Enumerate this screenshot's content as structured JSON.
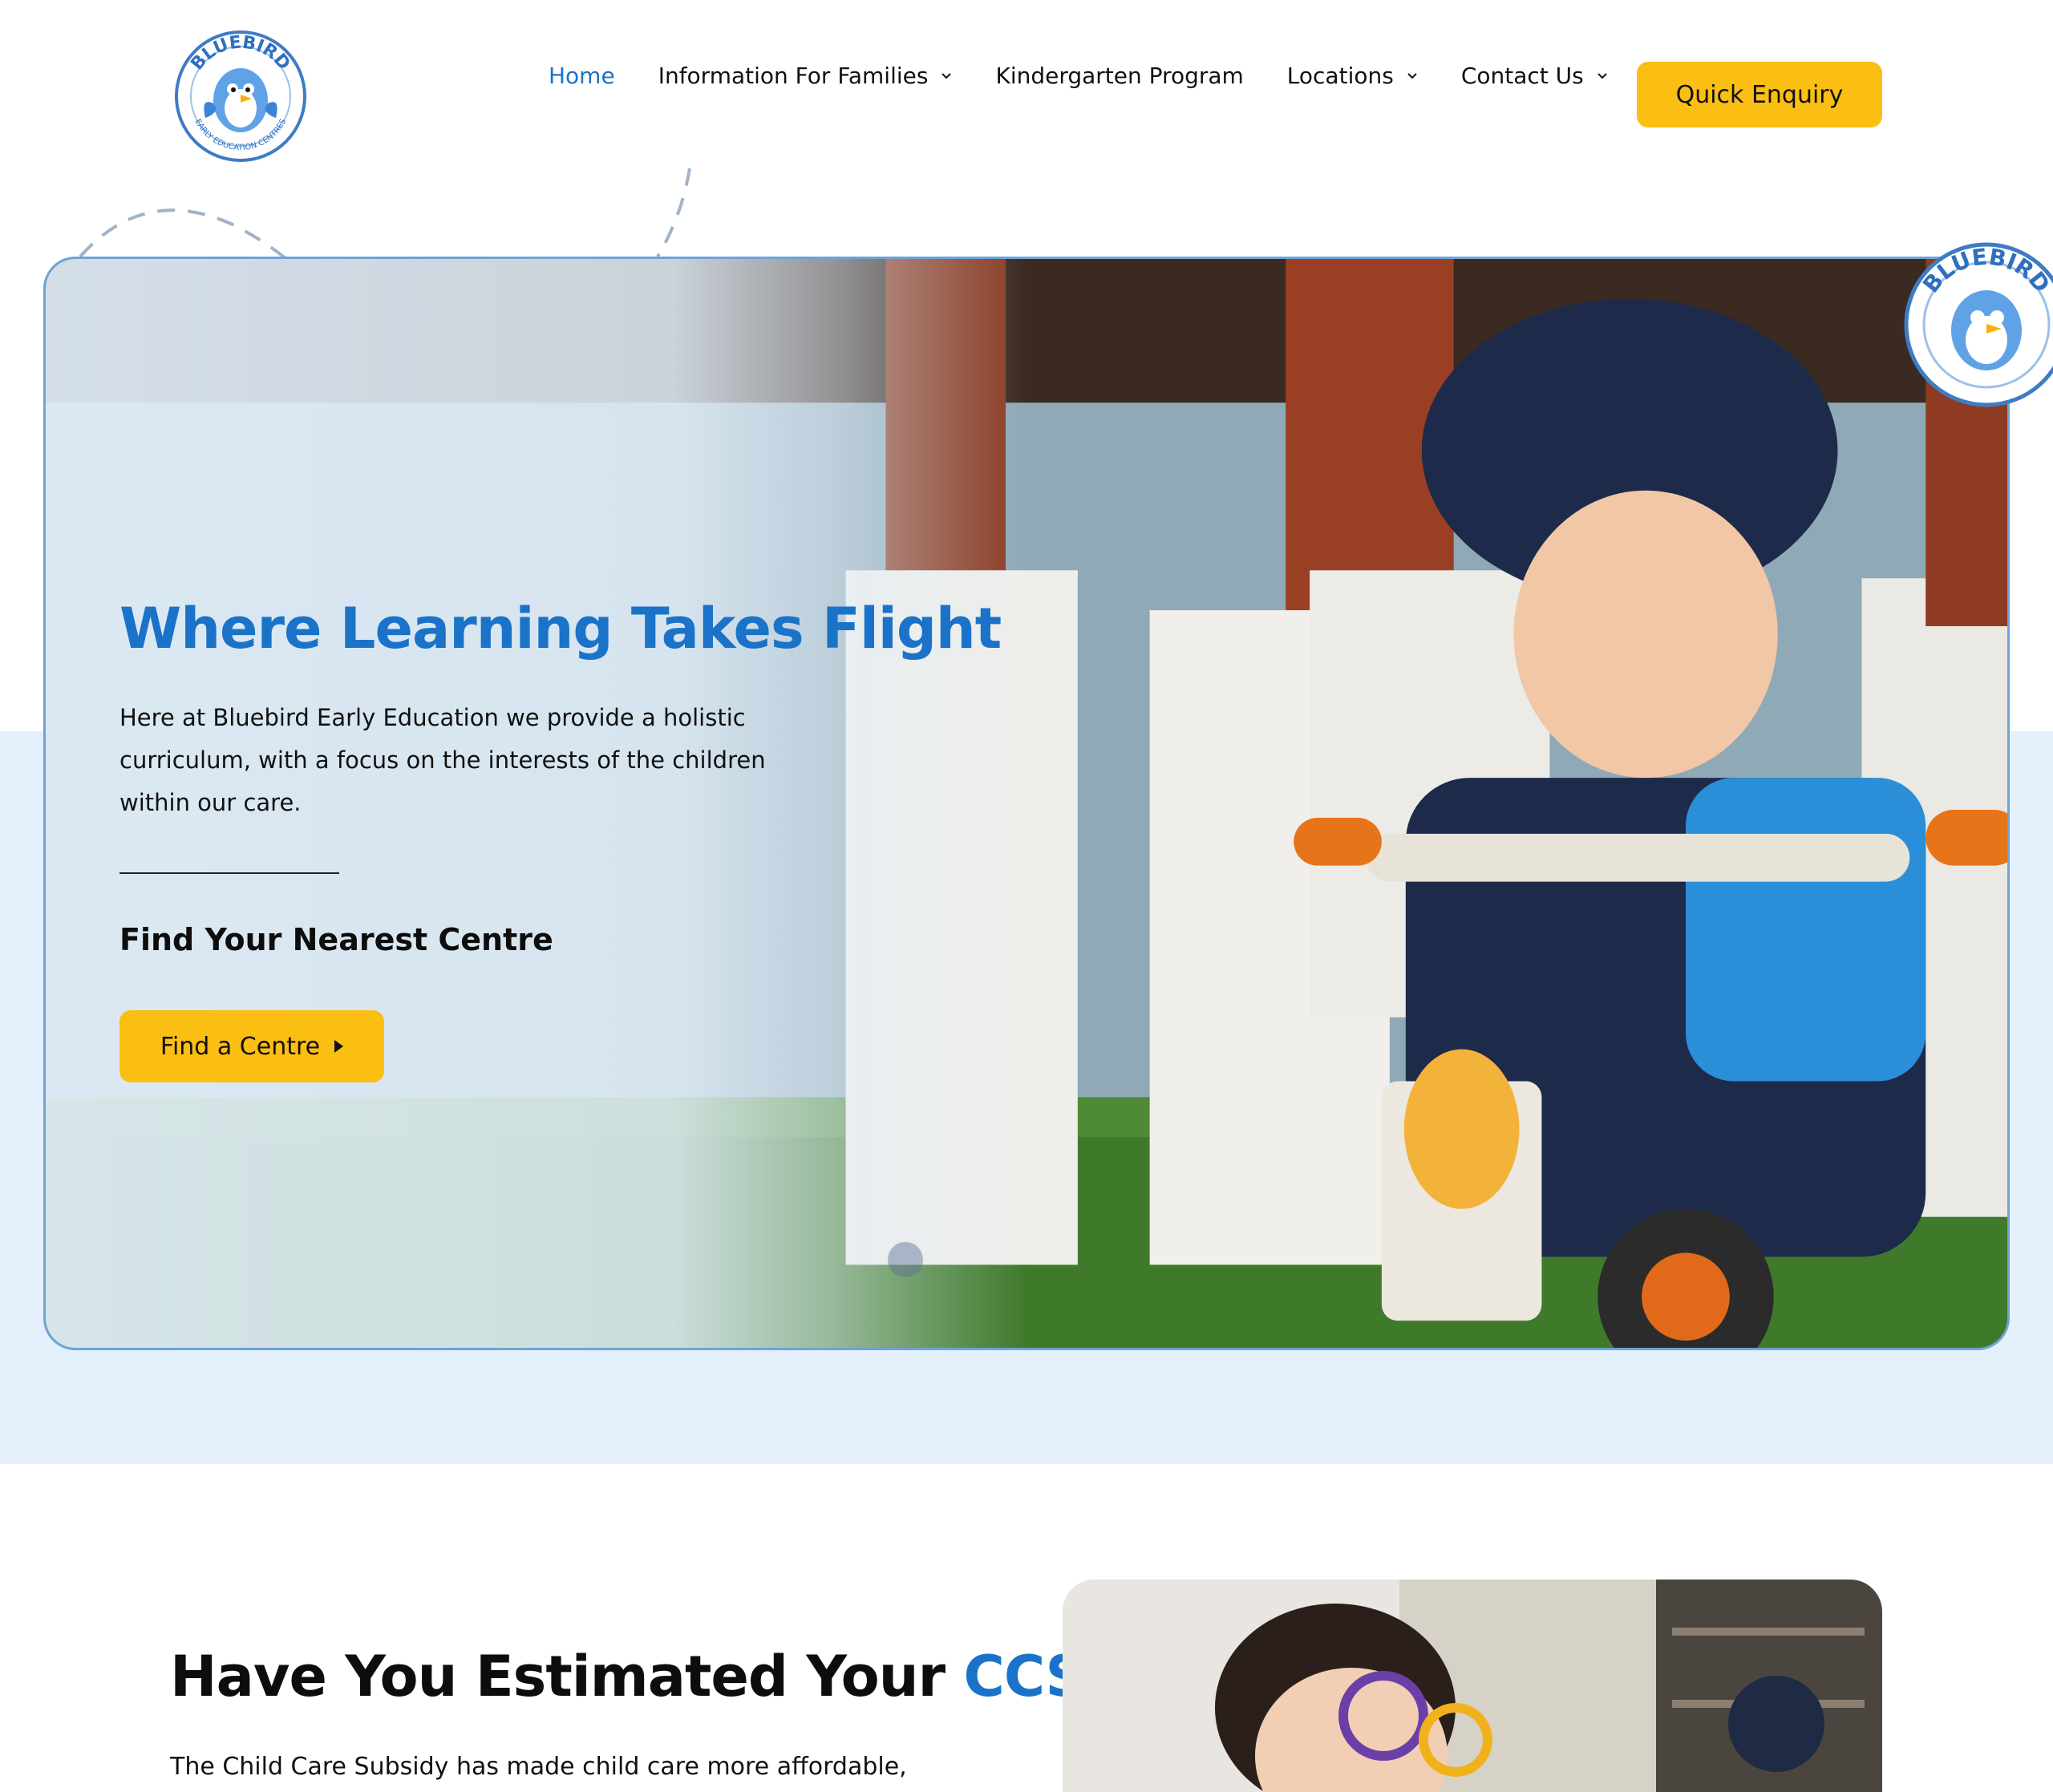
{
  "brand": {
    "logo_text_top": "BLUEBIRD",
    "logo_text_bottom": "EARLY EDUCATION CENTRES"
  },
  "nav": {
    "items": [
      {
        "label": "Home",
        "active": true,
        "has_dropdown": false
      },
      {
        "label": "Information For Families",
        "active": false,
        "has_dropdown": true
      },
      {
        "label": "Kindergarten Program",
        "active": false,
        "has_dropdown": false
      },
      {
        "label": "Locations",
        "active": false,
        "has_dropdown": true
      },
      {
        "label": "Contact Us",
        "active": false,
        "has_dropdown": true
      }
    ],
    "cta_label": "Quick Enquiry"
  },
  "hero": {
    "title": "Where Learning Takes Flight",
    "description": "Here at Bluebird Early Education we provide a holistic curriculum, with a focus on the interests of the children within our care.",
    "subheading": "Find Your Nearest Centre",
    "button_label": "Find a Centre",
    "photo_subject": "child-riding-tricycle-photo"
  },
  "ccs": {
    "title_main": "Have You Estimated Your ",
    "title_accent": "CCS?",
    "body": "The Child Care Subsidy has made child care more affordable,",
    "photo_subject": "child-with-magnifying-glasses-photo"
  },
  "colors": {
    "accent_blue": "#1a73c8",
    "cta_yellow": "#fbbe12",
    "hero_band": "#e4f0fb",
    "hero_border": "#6ea3d8"
  }
}
